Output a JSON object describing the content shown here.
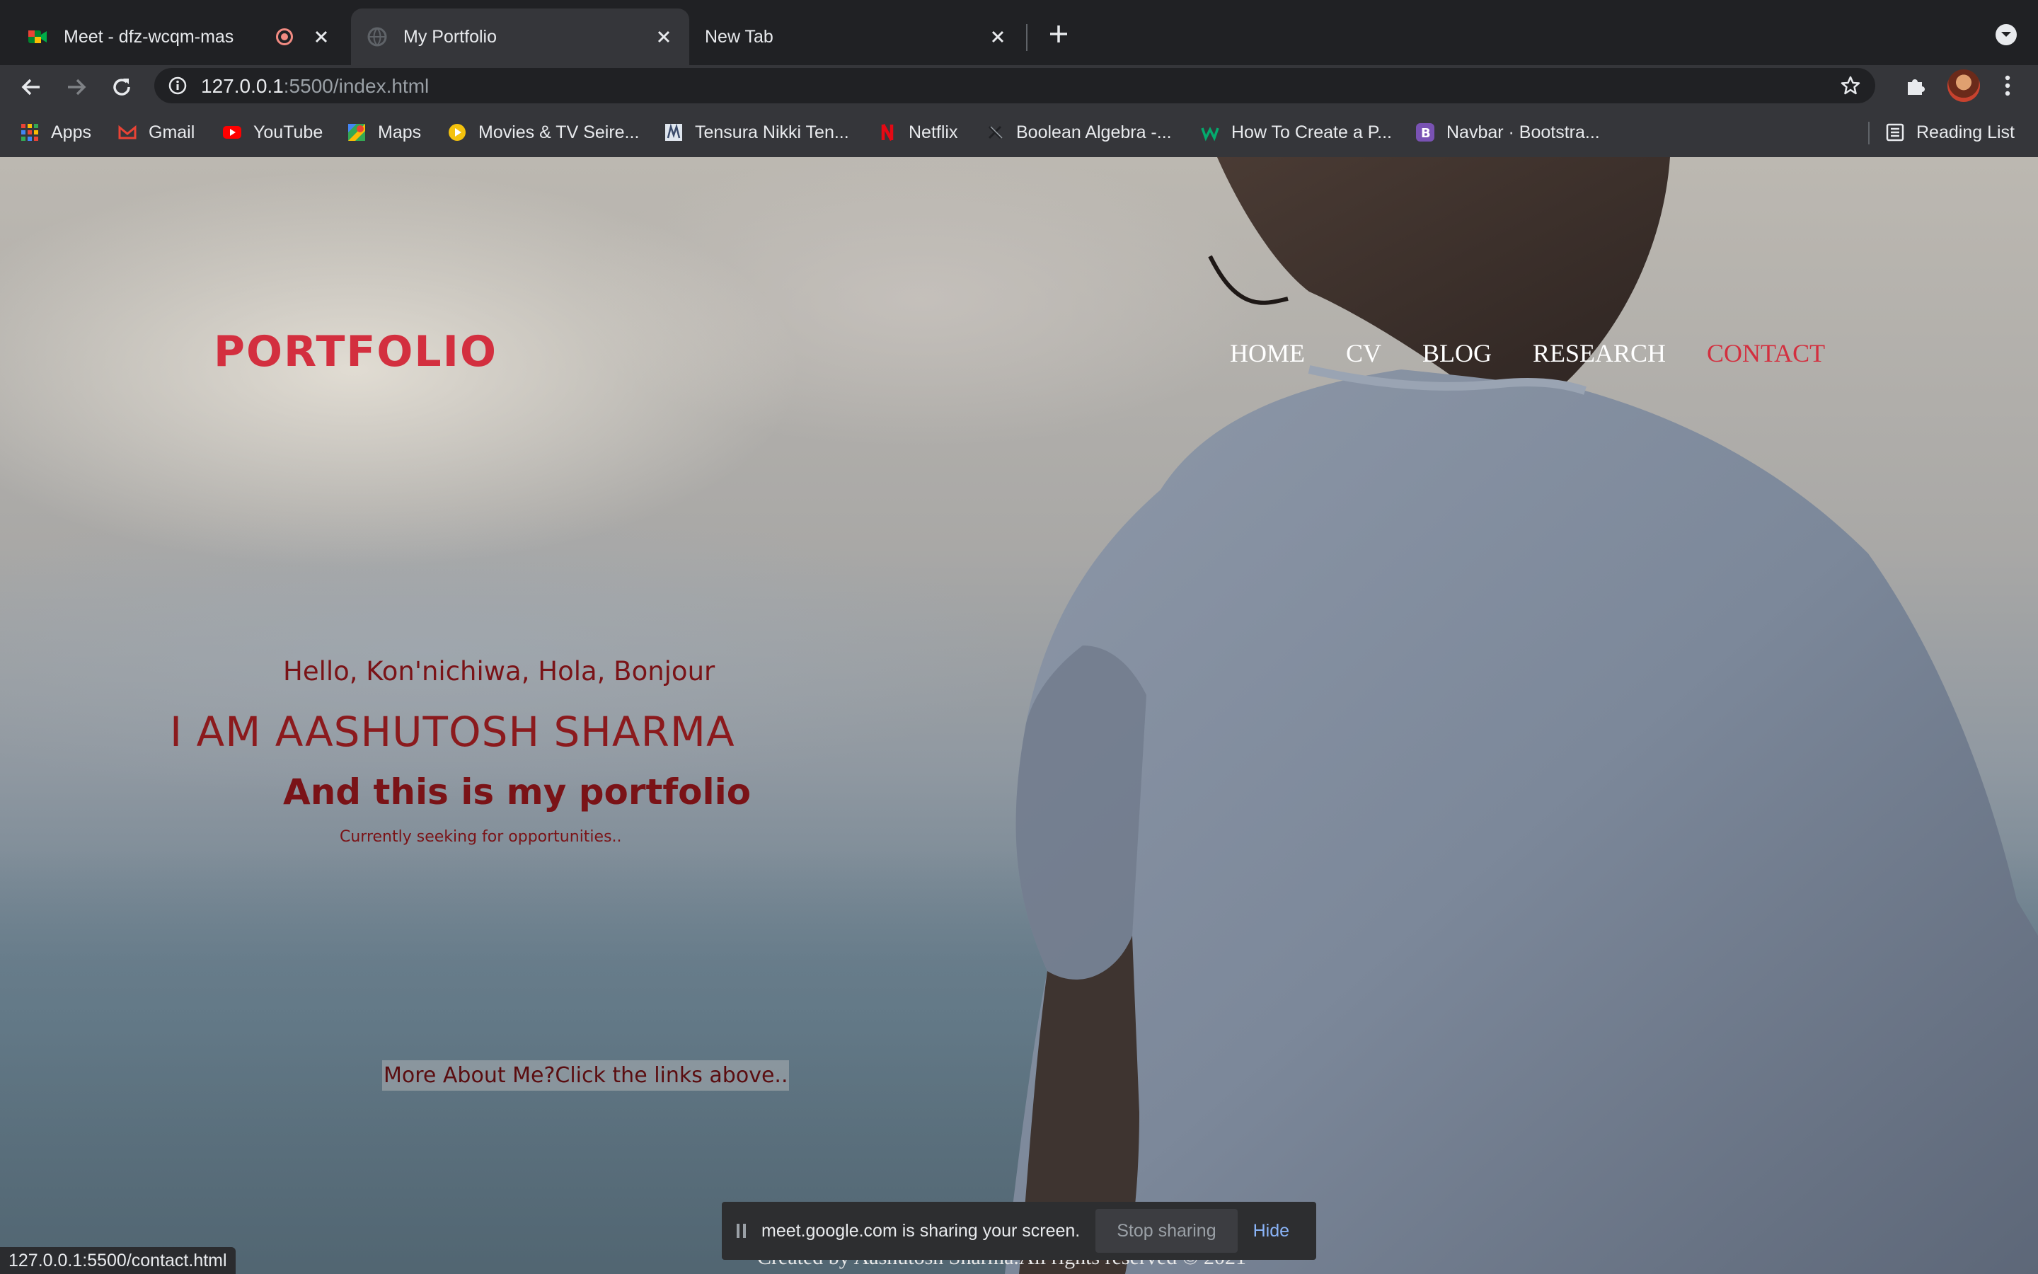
{
  "browser": {
    "tabs": [
      {
        "title": "Meet - dfz-wcqm-mas",
        "recording": true,
        "icon": "google-meet-icon"
      },
      {
        "title": "My Portfolio",
        "active": true,
        "icon": "globe-icon"
      },
      {
        "title": "New Tab",
        "icon": "none"
      }
    ],
    "address": {
      "host": "127.0.0.1",
      "path": ":5500/index.html"
    },
    "bookmarks": [
      {
        "label": "Apps",
        "icon": "apps-grid-icon"
      },
      {
        "label": "Gmail",
        "icon": "gmail-icon"
      },
      {
        "label": "YouTube",
        "icon": "youtube-icon"
      },
      {
        "label": "Maps",
        "icon": "maps-icon"
      },
      {
        "label": "Movies & TV Seire...",
        "icon": "movies-icon"
      },
      {
        "label": "Tensura Nikki Ten...",
        "icon": "manga-icon"
      },
      {
        "label": "Netflix",
        "icon": "netflix-icon"
      },
      {
        "label": "Boolean Algebra -...",
        "icon": "boolean-icon"
      },
      {
        "label": "How To Create a P...",
        "icon": "w3-icon"
      },
      {
        "label": "Navbar · Bootstra...",
        "icon": "bootstrap-icon"
      }
    ],
    "reading_list": "Reading List",
    "status_url": "127.0.0.1:5500/contact.html"
  },
  "page": {
    "logo": "PORTFOLIO",
    "nav": [
      "HOME",
      "CV",
      "BLOG",
      "RESEARCH",
      "CONTACT"
    ],
    "hello": "Hello, Kon'nichiwa, Hola, Bonjour",
    "name": "I AM AASHUTOSH SHARMA",
    "subtitle": "And this is my portfolio",
    "seeking": "Currently seeking for opportunities..",
    "more": "More About Me?Click the links above..",
    "footer": "Created by Aashutosh Sharma.All rights reserved © 2021"
  },
  "sharing": {
    "message": "meet.google.com is sharing your screen.",
    "stop": "Stop sharing",
    "hide": "Hide"
  },
  "colors": {
    "accent": "#d32f3f",
    "hero_text": "#7a1317",
    "link": "#8ab4f8"
  }
}
